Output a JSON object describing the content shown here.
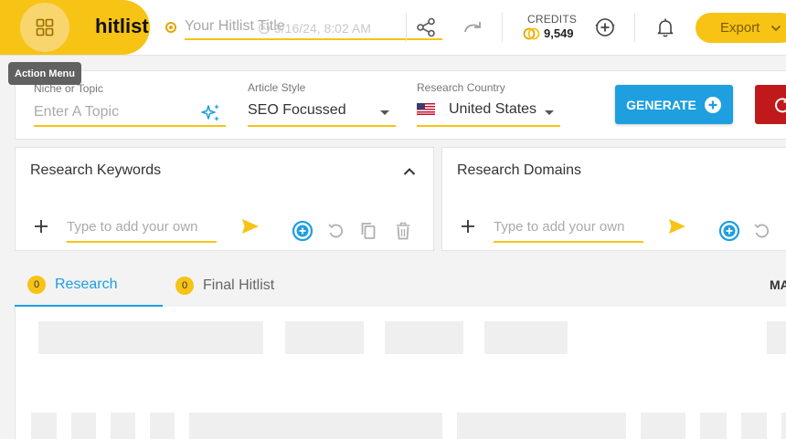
{
  "header": {
    "brand": "hitlist",
    "title_placeholder": "Your Hitlist Title",
    "timestamp": "9/16/24, 8:02 AM",
    "credits_label": "CREDITS",
    "credits_value": "9,549",
    "export_label": "Export",
    "tooltip": "Action Menu"
  },
  "settings": {
    "niche_label": "Niche or Topic",
    "niche_placeholder": "Enter A Topic",
    "style_label": "Article Style",
    "style_value": "SEO Focussed",
    "country_label": "Research Country",
    "country_value": "United States",
    "generate_label": "GENERATE"
  },
  "panels": {
    "keywords_title": "Research Keywords",
    "keywords_placeholder": "Type to add your own",
    "domains_title": "Research Domains",
    "domains_placeholder": "Type to add your own"
  },
  "tabs": [
    {
      "label": "Research",
      "count": "0"
    },
    {
      "label": "Final Hitlist",
      "count": "0"
    }
  ],
  "tabs_more": "MA",
  "colors": {
    "accent_yellow": "#f7c315",
    "accent_blue": "#1e9fe0",
    "danger_red": "#c0191b"
  },
  "icons": [
    "grid-icon",
    "clock-icon",
    "share-icon",
    "redo-icon",
    "coin-icon",
    "add-circle-icon",
    "bell-icon",
    "chevron-down-icon",
    "sparkle-icon",
    "us-flag-icon",
    "plus-circle-icon",
    "refresh-icon",
    "chevron-up-icon",
    "plus-icon",
    "send-icon",
    "undo-icon",
    "copy-icon",
    "trash-icon"
  ]
}
